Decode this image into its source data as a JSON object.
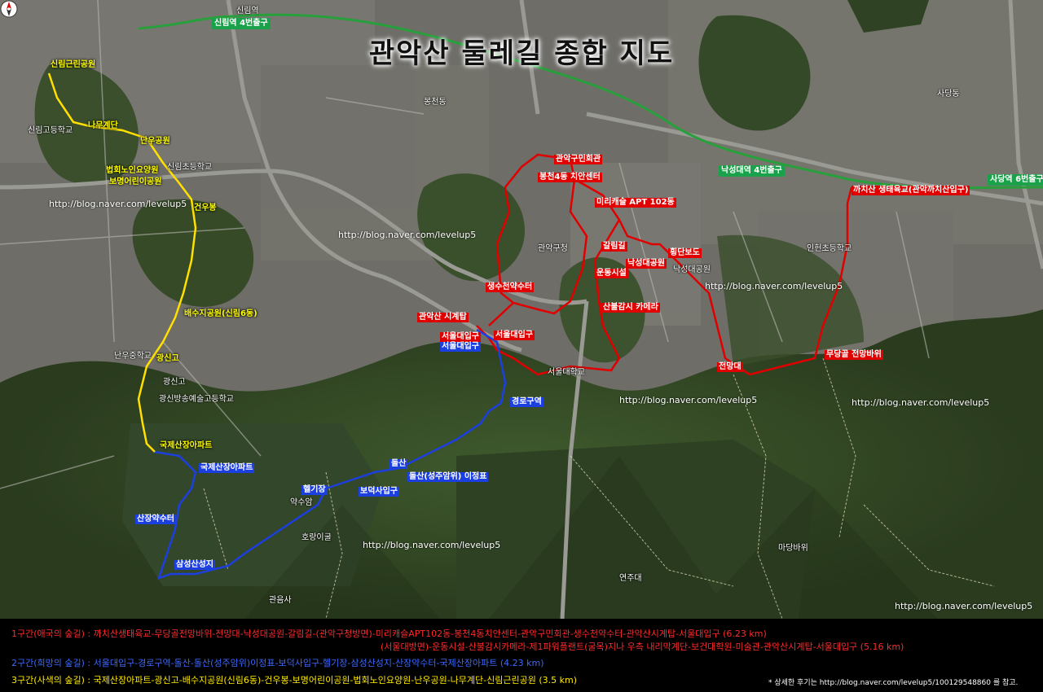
{
  "title": "관악산 둘레길 종합 지도",
  "watermark": "http://blog.naver.com/levelup5",
  "colors": {
    "course1": "#e00000",
    "course2": "#1c3fe0",
    "course3": "#ffe000",
    "road": "#8a8a8a",
    "subway": "#27a03b"
  },
  "course1_labels": [
    "까치산 생태육교(관악까치산입구)",
    "무당골 전망바위",
    "전망대",
    "낙성대공원",
    "횡단보도",
    "갈림길",
    "미리캐슬 APT 102동",
    "봉천4동 치안센터",
    "관악구민회관",
    "생수천약수터",
    "관악산 시계탑",
    "서울대입구",
    "산불감시 카메라",
    "운동시설",
    "서울대입구"
  ],
  "course2_labels": [
    "경로구역",
    "돌산",
    "돌산(성주암위) 이정표",
    "보덕사입구",
    "헬기장",
    "삼성산성지",
    "산장약수터",
    "국제산장아파트"
  ],
  "course3_labels": [
    "신림근린공원",
    "나무계단",
    "난우공원",
    "법회노인요양원",
    "보명어린이공원",
    "건우봉",
    "배수지공원(신림6동)",
    "광신고",
    "국제산장아파트"
  ],
  "stations": [
    "신림역 4번출구",
    "낙성대역 4번출구",
    "까치산 생태육교",
    "사당역 6번출구"
  ],
  "place_labels": [
    "신림역",
    "신림고등학교",
    "신림초등학교",
    "난우중학교",
    "광신고",
    "광신방송예술고등학교",
    "서울대학교",
    "관악구청",
    "봉천동",
    "인헌초등학교",
    "낙성대공원",
    "사당동",
    "호랑이굴",
    "관음사",
    "약수암",
    "마당바위",
    "연주대"
  ],
  "compass": "N",
  "legend": {
    "line1_label": "1구간(애국의 숲길) : 까치산생태육교-무당골전망바위-전망대-낙성대공원-갈림길-(관악구청방면)-미리캐슬APT102동-봉천4동치안센터-관악구민회관-생수천약수터-관악산시계탑-서울대입구 (6.23 km)",
    "line1b_label": "(서울대방면)-운동시설-산불감시카메라-제1파워플랜트(굴목)지나 우측 내리막계단-보건대학원-미술관-관악산시계탑-서울대입구 (5.16 km)",
    "line2_label": "2구간(희망의 숲길) : 서울대입구-경로구역-돌산-돌산(성주암위)이정표-보덕사입구-헬기장-삼성산성지-산장약수터-국제산장아파트 (4.23 km)",
    "line3_label": "3구간(사색의 숲길) : 국제산장아파트-광신고-배수지공원(신림6동)-건우봉-보명어린이공원-법회노인요양원-난우공원-나무계단-신림근린공원 (3.5 km)",
    "note": "* 상세한 후기는 http://blog.naver.com/levelup5/100129548860 를 참고."
  }
}
